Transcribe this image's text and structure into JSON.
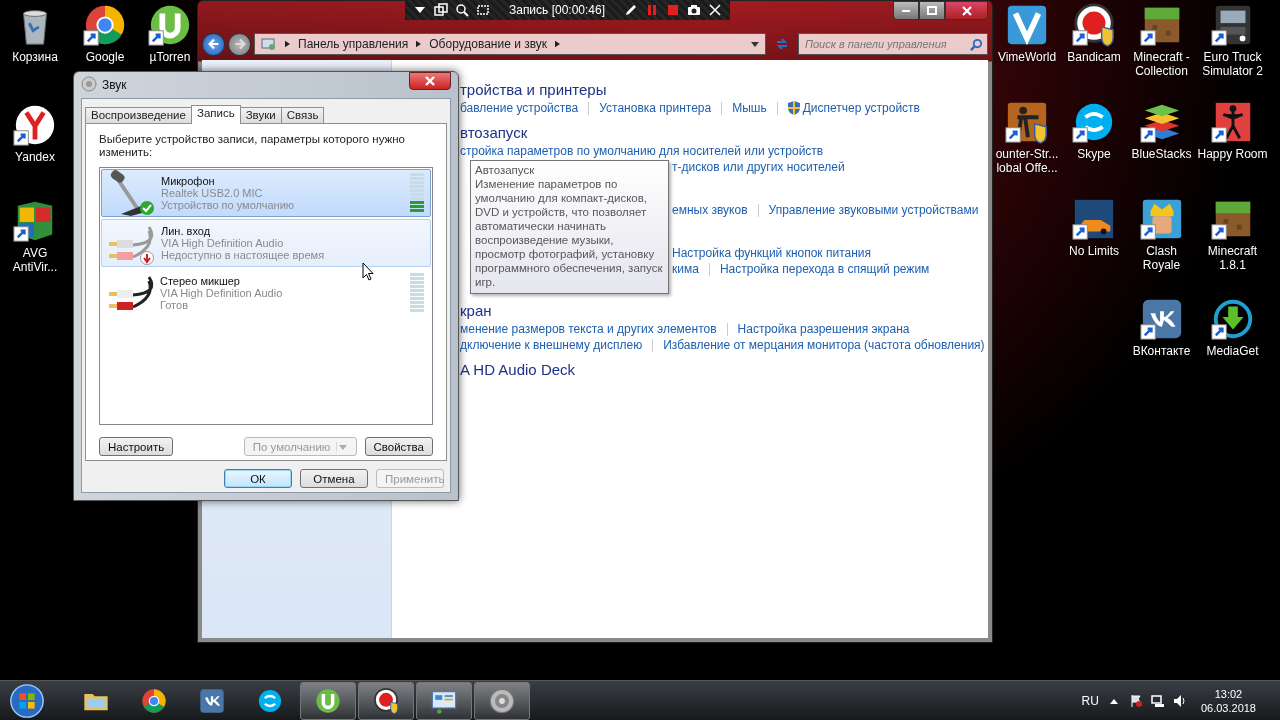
{
  "desktop": {
    "left_icons": [
      {
        "label": "Корзина",
        "kind": "trash",
        "shortcut": false
      },
      {
        "label": "Google",
        "kind": "chrome",
        "shortcut": true
      },
      {
        "label": "µTorren",
        "kind": "torrent",
        "shortcut": true
      },
      {
        "label": "Yandex",
        "kind": "yandex",
        "shortcut": true
      },
      {
        "label": "AVG AntiVir...",
        "kind": "avg",
        "shortcut": true
      }
    ],
    "right_icons": [
      {
        "label": "VimeWorld",
        "kind": "tile",
        "shortcut": false
      },
      {
        "label": "Bandicam",
        "kind": "record",
        "shortcut": true
      },
      {
        "label": "Minecraft - Collection",
        "kind": "grass",
        "shortcut": true
      },
      {
        "label": "Euro Truck Simulator 2",
        "kind": "truck",
        "shortcut": true
      },
      {
        "label": "ounter-Str... lobal Offe...",
        "kind": "soldier",
        "shortcut": true
      },
      {
        "label": "Skype",
        "kind": "chat",
        "shortcut": true
      },
      {
        "label": "BlueStacks",
        "kind": "layers",
        "shortcut": true
      },
      {
        "label": "Happy Room",
        "kind": "figure",
        "shortcut": true
      },
      {
        "label": "No Limits",
        "kind": "car",
        "shortcut": true
      },
      {
        "label": "Clash Royale",
        "kind": "crown",
        "shortcut": true
      },
      {
        "label": "Minecraft 1.8.1",
        "kind": "grass",
        "shortcut": true
      },
      {
        "label": "ВКонтакте",
        "kind": "social",
        "shortcut": true
      },
      {
        "label": "MediaGet",
        "kind": "download",
        "shortcut": true
      }
    ]
  },
  "recorder_bar": {
    "title": "Запись [00:00:46]"
  },
  "control_panel": {
    "breadcrumb": [
      "Панель управления",
      "Оборудование и звук"
    ],
    "search": {
      "placeholder": "Поиск в панели управления"
    },
    "sections": [
      {
        "title": "тройства и принтеры",
        "lines": [
          {
            "clipped": false,
            "links": [
              {
                "text": "бавление устройства"
              },
              {
                "text": "Установка принтера"
              },
              {
                "text": "Мышь"
              },
              {
                "text": "Диспетчер устройств",
                "shield": true
              }
            ]
          }
        ]
      },
      {
        "title": "втозапуск",
        "lines": [
          {
            "clipped": false,
            "links": [
              {
                "text": "стройка параметров по умолчанию для носителей или устройств"
              }
            ]
          },
          {
            "clipped": true,
            "links": [
              {
                "text": "т-дисков или других носителей"
              }
            ]
          }
        ]
      },
      {
        "lines": [
          {
            "clipped": true,
            "links": [
              {
                "text": "емных звуков"
              },
              {
                "text": "Управление звуковыми устройствами"
              }
            ]
          }
        ]
      },
      {
        "lines": [
          {
            "clipped": true,
            "links": [
              {
                "text": "Настройка функций кнопок питания"
              }
            ]
          },
          {
            "clipped": true,
            "links": [
              {
                "text": "кима"
              },
              {
                "text": "Настройка перехода в спящий режим"
              }
            ]
          }
        ]
      },
      {
        "title": "кран",
        "lines": [
          {
            "clipped": false,
            "links": [
              {
                "text": "менение размеров текста и других элементов"
              },
              {
                "text": "Настройка разрешения экрана"
              }
            ]
          },
          {
            "clipped": false,
            "links": [
              {
                "text": "дключение к внешнему дисплею"
              },
              {
                "text": "Избавление от мерцания монитора (частота обновления)"
              }
            ]
          }
        ]
      },
      {
        "title": "A HD Audio Deck"
      }
    ]
  },
  "tooltip": {
    "title": "Автозапуск",
    "text": "Изменение параметров по умолчанию для компакт-дисков, DVD и устройств, что позволяет автоматически начинать воспроизведение музыки, просмотр фотографий, установку программного обеспечения, запуск игр."
  },
  "sound_dialog": {
    "title": "Звук",
    "tabs": [
      {
        "label": "Воспроизведение",
        "selected": false
      },
      {
        "label": "Запись",
        "selected": true
      },
      {
        "label": "Звуки",
        "selected": false
      },
      {
        "label": "Связь",
        "selected": false
      }
    ],
    "prompt": "Выберите устройство записи, параметры которого нужно изменить:",
    "devices": [
      {
        "kind": "microphone",
        "name": "Микрофон",
        "driver": "Realtek USB2.0 MIC",
        "status": "Устройство по умолчанию",
        "is_default": true,
        "unavailable": false,
        "selected": true,
        "hovered": false,
        "meter": {
          "level": 0.3
        }
      },
      {
        "kind": "line-in",
        "name": "Лин. вход",
        "driver": "VIA High Definition Audio",
        "status": "Недоступно в настоящее время",
        "is_default": false,
        "unavailable": true,
        "selected": false,
        "hovered": true
      },
      {
        "kind": "stereo-mix",
        "name": "Стерео микшер",
        "driver": "VIA High Definition Audio",
        "status": "Готов",
        "is_default": false,
        "unavailable": false,
        "selected": false,
        "hovered": false,
        "meter": {
          "level": 0
        }
      }
    ],
    "configure_button": {
      "label": "Настроить",
      "disabled": false
    },
    "default_button": {
      "label": "По умолчанию",
      "disabled": true
    },
    "properties_button": {
      "label": "Свойства",
      "disabled": false
    },
    "footer_buttons": [
      {
        "label": "ОК",
        "disabled": false,
        "focused": true
      },
      {
        "label": "Отмена",
        "disabled": false,
        "focused": false
      },
      {
        "label": "Применить",
        "disabled": true,
        "focused": false
      }
    ]
  },
  "taskbar": {
    "items": [
      {
        "kind": "folder",
        "active": false
      },
      {
        "kind": "chrome",
        "active": false
      },
      {
        "kind": "social",
        "active": false
      },
      {
        "kind": "chat",
        "active": false
      },
      {
        "kind": "torrent",
        "active": true
      },
      {
        "kind": "record",
        "active": true
      },
      {
        "kind": "control-panel",
        "active": true
      },
      {
        "kind": "speaker",
        "active": true
      }
    ],
    "language": "RU",
    "time": "13:02",
    "date": "06.03.2018"
  }
}
